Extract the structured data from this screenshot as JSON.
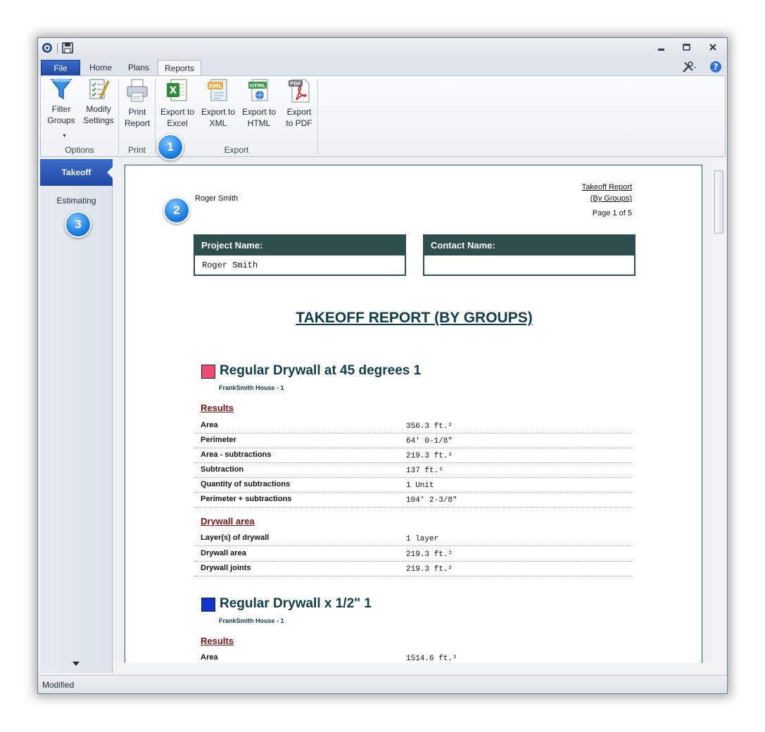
{
  "tabs": {
    "file": "File",
    "home": "Home",
    "plans": "Plans",
    "reports": "Reports"
  },
  "ribbon": {
    "filter_groups": [
      "Filter",
      "Groups"
    ],
    "modify_settings": [
      "Modify",
      "Settings"
    ],
    "print_report": [
      "Print",
      "Report"
    ],
    "export_excel": [
      "Export to",
      "Excel"
    ],
    "export_xml": [
      "Export to",
      "XML"
    ],
    "export_html": [
      "Export to",
      "HTML"
    ],
    "export_pdf": [
      "Export",
      "to PDF"
    ],
    "groups": {
      "options": "Options",
      "print": "Print",
      "export": "Export"
    }
  },
  "callouts": [
    "1",
    "2",
    "3"
  ],
  "nav": {
    "takeoff": "Takeoff",
    "estimating": "Estimating"
  },
  "status": "Modified",
  "report": {
    "author": "Roger Smith",
    "header_title": "Takeoff Report",
    "header_sub": "(By Groups)",
    "page": "Page 1 of 5",
    "project_label": "Project Name:",
    "project_value": "Roger Smith",
    "contact_label": "Contact Name:",
    "contact_value": "",
    "title": "TAKEOFF REPORT (BY GROUPS)",
    "groups": [
      {
        "name": "Regular Drywall at 45 degrees 1",
        "color": "#ee4d78",
        "location": "FrankSmith House - 1",
        "results_label": "Results",
        "results": [
          {
            "k": "Area",
            "v": "356.3 ft.²"
          },
          {
            "k": "Perimeter",
            "v": "64' 0-1/8\""
          },
          {
            "k": "Area - subtractions",
            "v": "219.3 ft.²"
          },
          {
            "k": "Subtraction",
            "v": "137 ft.²"
          },
          {
            "k": "Quantity of subtractions",
            "v": "1 Unit"
          },
          {
            "k": "Perimeter + subtractions",
            "v": "104' 2-3/8\""
          }
        ],
        "drywall_label": "Drywall area",
        "drywall": [
          {
            "k": "Layer(s) of drywall",
            "v": "1 layer"
          },
          {
            "k": "Drywall area",
            "v": "219.3 ft.²"
          },
          {
            "k": "Drywall joints",
            "v": "219.3 ft.²"
          }
        ]
      },
      {
        "name": "Regular Drywall x 1/2\" 1",
        "color": "#1235c9",
        "location": "FrankSmith House - 1",
        "results_label": "Results",
        "results": [
          {
            "k": "Area",
            "v": "1514.6 ft.²"
          }
        ]
      }
    ]
  }
}
